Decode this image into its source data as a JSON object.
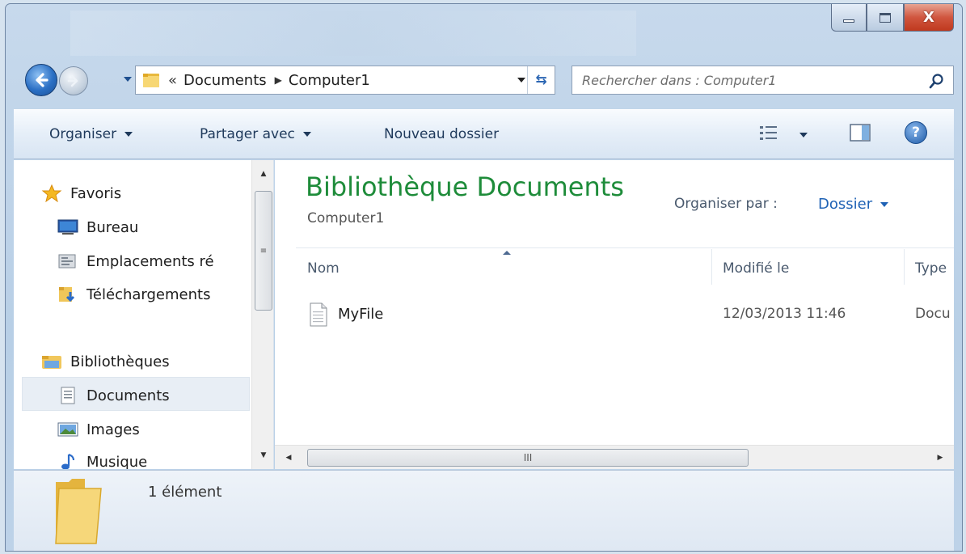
{
  "window": {
    "caption": {
      "minimize": "minimize",
      "maximize": "maximize",
      "close": "X"
    }
  },
  "address": {
    "overflow": "«",
    "segments": [
      "Documents",
      "Computer1"
    ]
  },
  "search": {
    "placeholder": "Rechercher dans : Computer1"
  },
  "toolbar": {
    "organize": "Organiser",
    "share": "Partager avec",
    "new_folder": "Nouveau dossier",
    "help": "?"
  },
  "nav": {
    "favorites": "Favoris",
    "desktop": "Bureau",
    "recent": "Emplacements ré",
    "downloads": "Téléchargements",
    "libraries": "Bibliothèques",
    "documents": "Documents",
    "images": "Images",
    "music": "Musique"
  },
  "library": {
    "title": "Bibliothèque Documents",
    "subtitle": "Computer1",
    "arrange_label": "Organiser par :",
    "arrange_value": "Dossier"
  },
  "columns": {
    "name": "Nom",
    "modified": "Modifié le",
    "type": "Type"
  },
  "files": [
    {
      "name": "MyFile",
      "modified": "12/03/2013 11:46",
      "type": "Docu"
    }
  ],
  "hscroll_grip": "III",
  "status": {
    "count": "1 élément"
  },
  "colors": {
    "accent_green": "#1e8c3a",
    "link_blue": "#1f62b5"
  }
}
